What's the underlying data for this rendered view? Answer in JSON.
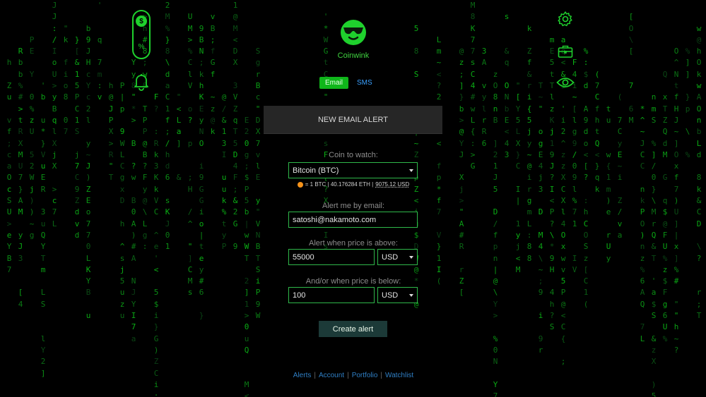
{
  "brand": {
    "name": "Coinwink"
  },
  "tabs": {
    "email": "Email",
    "sms": "SMS"
  },
  "sidebar_left": {
    "dollar": "$",
    "percent": "%"
  },
  "panel": {
    "title": "NEW EMAIL ALERT",
    "coin_label": "Coin to watch:",
    "coin_value": "Bitcoin (BTC)",
    "rate_main": "= 1 BTC | 40.176284 ETH |",
    "rate_usd": "9075.12 USD",
    "email_label": "Alert me by email:",
    "email_value": "satoshi@nakamoto.com",
    "above_label": "Alert when price is above:",
    "above_value": "55000",
    "above_currency": "USD",
    "below_label": "And/or when price is below:",
    "below_value": "100",
    "below_currency": "USD",
    "create_button": "Create alert"
  },
  "footer_nav": [
    "Alerts",
    "Account",
    "Portfolio",
    "Watchlist"
  ],
  "icons": {
    "logo": "coinwink-logo-icon",
    "bell": "bell-icon",
    "settings": "gear-icon",
    "portfolio": "briefcase-icon",
    "watchlist": "eye-icon"
  },
  "colors": {
    "matrix_green": "#1fd12d",
    "tab_active": "#0fb61a",
    "link_blue": "#3aa0ff"
  }
}
